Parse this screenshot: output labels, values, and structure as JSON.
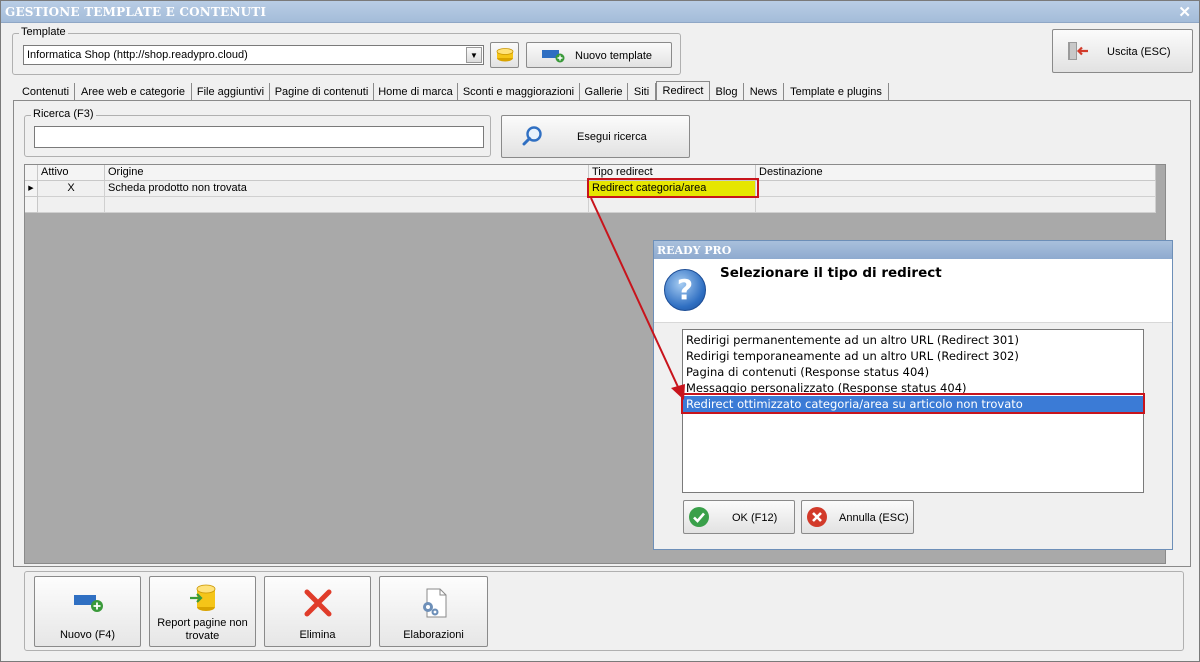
{
  "window": {
    "title": "GESTIONE TEMPLATE E CONTENUTI",
    "close": "✕"
  },
  "template": {
    "legend": "Template",
    "selected": "Informatica Shop (http://shop.readypro.cloud)",
    "new_button": "Nuovo template"
  },
  "exit_button": "Uscita (ESC)",
  "tabs": [
    {
      "label": "Contenuti"
    },
    {
      "label": "Aree web e categorie"
    },
    {
      "label": "File aggiuntivi"
    },
    {
      "label": "Pagine di contenuti"
    },
    {
      "label": "Home di marca"
    },
    {
      "label": "Sconti e maggiorazioni"
    },
    {
      "label": "Gallerie"
    },
    {
      "label": "Siti"
    },
    {
      "label": "Redirect"
    },
    {
      "label": "Blog"
    },
    {
      "label": "News"
    },
    {
      "label": "Template e plugins"
    }
  ],
  "active_tab": "Redirect",
  "search": {
    "legend": "Ricerca (F3)",
    "value": "",
    "button": "Esegui ricerca"
  },
  "grid": {
    "headers": [
      "Attivo",
      "Origine",
      "Tipo redirect",
      "Destinazione"
    ],
    "rows": [
      {
        "attivo": "X",
        "origine": "Scheda prodotto non trovata",
        "tipo": "Redirect categoria/area",
        "destinazione": ""
      }
    ],
    "current_row_marker": "▶"
  },
  "dialog": {
    "title": "READY PRO",
    "heading": "Selezionare il tipo di redirect",
    "icon_glyph": "?",
    "options": [
      "Redirigi permanentemente ad un altro URL (Redirect 301)",
      "Redirigi temporaneamente ad un altro URL (Redirect 302)",
      "Pagina di contenuti (Response status 404)",
      "Messaggio personalizzato (Response status 404)",
      "Redirect ottimizzato categoria/area su articolo non trovato"
    ],
    "selected_index": 4,
    "ok": "OK (F12)",
    "cancel": "Annulla (ESC)"
  },
  "bottom_buttons": {
    "new": "Nuovo (F4)",
    "report_line1": "Report pagine non",
    "report_line2": "trovate",
    "delete": "Elimina",
    "processing": "Elaborazioni"
  },
  "colors": {
    "highlight_cell": "#e6e600",
    "annotation_red": "#c8141c",
    "selection_blue": "#3b7bd6",
    "title_blue": "#a4bcd9"
  }
}
